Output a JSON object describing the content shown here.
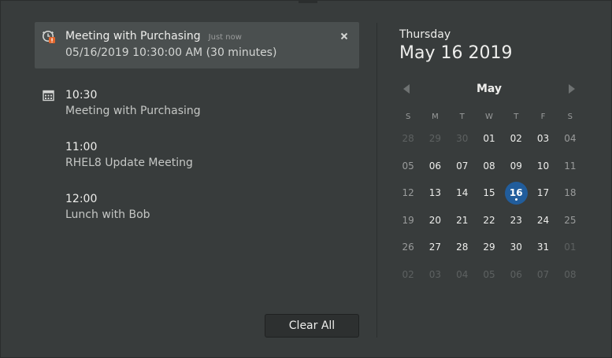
{
  "notification": {
    "title": "Meeting with Purchasing",
    "time": "Just now",
    "body": "05/16/2019 10:30:00 AM (30 minutes)",
    "icon": "alarm-clock-warning-icon"
  },
  "events": [
    {
      "time": "10:30",
      "title": "Meeting with Purchasing"
    },
    {
      "time": "11:00",
      "title": "RHEL8 Update Meeting"
    },
    {
      "time": "12:00",
      "title": "Lunch with Bob"
    }
  ],
  "clear_all_label": "Clear All",
  "calendar": {
    "weekday": "Thursday",
    "date": "May 16 2019",
    "month": "May",
    "dow": [
      "S",
      "M",
      "T",
      "W",
      "T",
      "F",
      "S"
    ],
    "today": "16",
    "accent_color": "#215d9c",
    "weeks": [
      [
        "28",
        "29",
        "30",
        "01",
        "02",
        "03",
        "04"
      ],
      [
        "05",
        "06",
        "07",
        "08",
        "09",
        "10",
        "11"
      ],
      [
        "12",
        "13",
        "14",
        "15",
        "16",
        "17",
        "18"
      ],
      [
        "19",
        "20",
        "21",
        "22",
        "23",
        "24",
        "25"
      ],
      [
        "26",
        "27",
        "28",
        "29",
        "30",
        "31",
        "01"
      ],
      [
        "02",
        "03",
        "04",
        "05",
        "06",
        "07",
        "08"
      ]
    ]
  }
}
